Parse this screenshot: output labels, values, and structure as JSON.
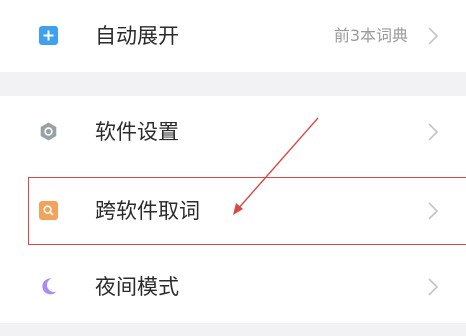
{
  "settings": {
    "rows": [
      {
        "label": "自动展开",
        "value": "前3本词典",
        "icon": "plus-square-icon",
        "icon_color": "#3fa0f0"
      },
      {
        "label": "软件设置",
        "value": "",
        "icon": "gear-circle-icon",
        "icon_color": "#9aa0a8"
      },
      {
        "label": "跨软件取词",
        "value": "",
        "icon": "search-square-icon",
        "icon_color": "#f3a25b"
      },
      {
        "label": "夜间模式",
        "value": "",
        "icon": "moon-icon",
        "icon_color": "#a88ef0"
      }
    ]
  },
  "annotation": {
    "color": "#d94a45"
  }
}
